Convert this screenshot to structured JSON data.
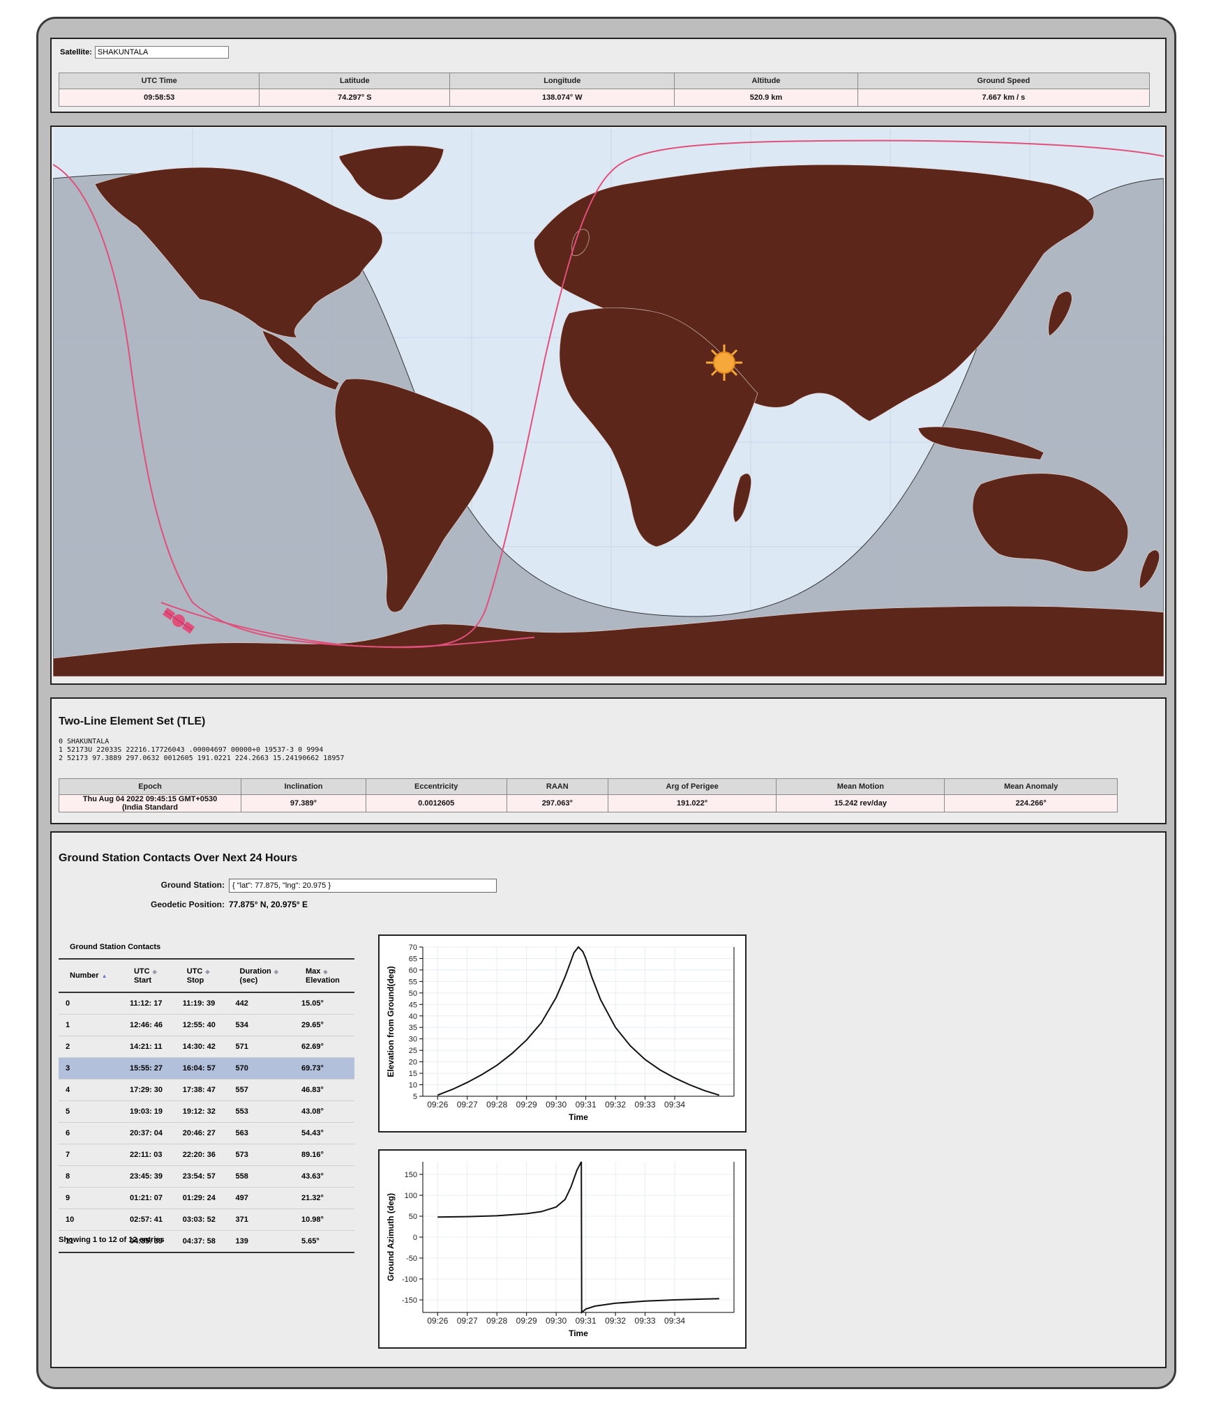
{
  "satellite": {
    "label": "Satellite:",
    "value": "SHAKUNTALA"
  },
  "telemetry": {
    "headers": [
      "UTC Time",
      "Latitude",
      "Longitude",
      "Altitude",
      "Ground Speed"
    ],
    "values": [
      "09:58:53",
      "74.297° S",
      "138.074° W",
      "520.9 km",
      "7.667 km / s"
    ]
  },
  "map": {
    "sun_icon": "sun-icon",
    "satellite_icon": "satellite-icon",
    "colors": {
      "ocean": "#dde8f5",
      "land": "#5c261b",
      "night": "#a9b1bd",
      "track": "#e0507a",
      "sun": "#f7a83a"
    }
  },
  "tle": {
    "title": "Two-Line Element Set (TLE)",
    "line0": "0 SHAKUNTALA",
    "line1": "1 52173U 22033S 22216.17726043 .00004697 00000+0 19537-3 0 9994",
    "line2": "2 52173 97.3889 297.0632 0012605 191.0221 224.2663 15.24190662 18957",
    "headers": [
      "Epoch",
      "Inclination",
      "Eccentricity",
      "RAAN",
      "Arg of Perigee",
      "Mean Motion",
      "Mean Anomaly"
    ],
    "values": [
      "Thu Aug 04 2022 09:45:15 GMT+0530 (India Standard",
      "97.389°",
      "0.0012605",
      "297.063°",
      "191.022°",
      "15.242 rev/day",
      "224.266°"
    ]
  },
  "ground_station": {
    "title": "Ground Station Contacts Over Next 24 Hours",
    "station_label": "Ground Station:",
    "station_value": "{ \"lat\": 77.875, \"lng\": 20.975 }",
    "position_label": "Geodetic Position:",
    "position_value": "77.875° N, 20.975° E",
    "contacts_title": "Ground Station Contacts",
    "columns": [
      {
        "l1": "Number",
        "l2": ""
      },
      {
        "l1": "UTC",
        "l2": "Start"
      },
      {
        "l1": "UTC",
        "l2": "Stop"
      },
      {
        "l1": "Duration",
        "l2": "(sec)"
      },
      {
        "l1": "Max",
        "l2": "Elevation"
      }
    ],
    "rows": [
      [
        "0",
        "11:12: 17",
        "11:19: 39",
        "442",
        "15.05°"
      ],
      [
        "1",
        "12:46: 46",
        "12:55: 40",
        "534",
        "29.65°"
      ],
      [
        "2",
        "14:21: 11",
        "14:30: 42",
        "571",
        "62.69°"
      ],
      [
        "3",
        "15:55: 27",
        "16:04: 57",
        "570",
        "69.73°"
      ],
      [
        "4",
        "17:29: 30",
        "17:38: 47",
        "557",
        "46.83°"
      ],
      [
        "5",
        "19:03: 19",
        "19:12: 32",
        "553",
        "43.08°"
      ],
      [
        "6",
        "20:37: 04",
        "20:46: 27",
        "563",
        "54.43°"
      ],
      [
        "7",
        "22:11: 03",
        "22:20: 36",
        "573",
        "89.16°"
      ],
      [
        "8",
        "23:45: 39",
        "23:54: 57",
        "558",
        "43.63°"
      ],
      [
        "9",
        "01:21: 07",
        "01:29: 24",
        "497",
        "21.32°"
      ],
      [
        "10",
        "02:57: 41",
        "03:03: 52",
        "371",
        "10.98°"
      ],
      [
        "11",
        "04:35: 39",
        "04:37: 58",
        "139",
        "5.65°"
      ]
    ],
    "selected_row": 3,
    "entries_text": "Showing 1 to 12 of 12 entries"
  },
  "chart_data": [
    {
      "type": "line",
      "xlabel": "Time",
      "ylabel": "Elevation from Ground(deg)",
      "xticks": [
        "09:26",
        "09:27",
        "09:28",
        "09:29",
        "09:30",
        "09:31",
        "09:32",
        "09:33",
        "09:34"
      ],
      "ylim": [
        5,
        70
      ],
      "yticks": [
        5,
        10,
        15,
        20,
        25,
        30,
        35,
        40,
        45,
        50,
        55,
        60,
        65,
        70
      ],
      "x_minutes": [
        0,
        0.5,
        1,
        1.5,
        2,
        2.5,
        3,
        3.5,
        4,
        4.3,
        4.5,
        4.6,
        4.75,
        4.9,
        5.0,
        5.2,
        5.5,
        6,
        6.5,
        7,
        7.5,
        8,
        8.5,
        9,
        9.5
      ],
      "values": [
        5.5,
        8,
        11,
        14.5,
        18.5,
        23.5,
        29.5,
        37,
        48,
        57,
        64,
        67.5,
        70,
        68,
        65,
        57,
        47,
        35,
        27,
        21,
        16.5,
        13,
        10,
        7.5,
        5.5
      ],
      "grid": true
    },
    {
      "type": "line",
      "xlabel": "Time",
      "ylabel": "Ground Azimuth (deg)",
      "xticks": [
        "09:26",
        "09:27",
        "09:28",
        "09:29",
        "09:30",
        "09:31",
        "09:32",
        "09:33",
        "09:34"
      ],
      "ylim": [
        -180,
        180
      ],
      "yticks": [
        150,
        100,
        50,
        0,
        -50,
        -100,
        -150
      ],
      "x_minutes": [
        0,
        1,
        2,
        3,
        3.5,
        4,
        4.3,
        4.5,
        4.7,
        4.85,
        4.86,
        5.0,
        5.3,
        6,
        7,
        8,
        9,
        9.5
      ],
      "values": [
        48,
        49,
        51,
        56,
        61,
        72,
        90,
        120,
        160,
        180,
        -180,
        -172,
        -165,
        -158,
        -153,
        -150,
        -148,
        -147
      ],
      "grid": true
    }
  ]
}
